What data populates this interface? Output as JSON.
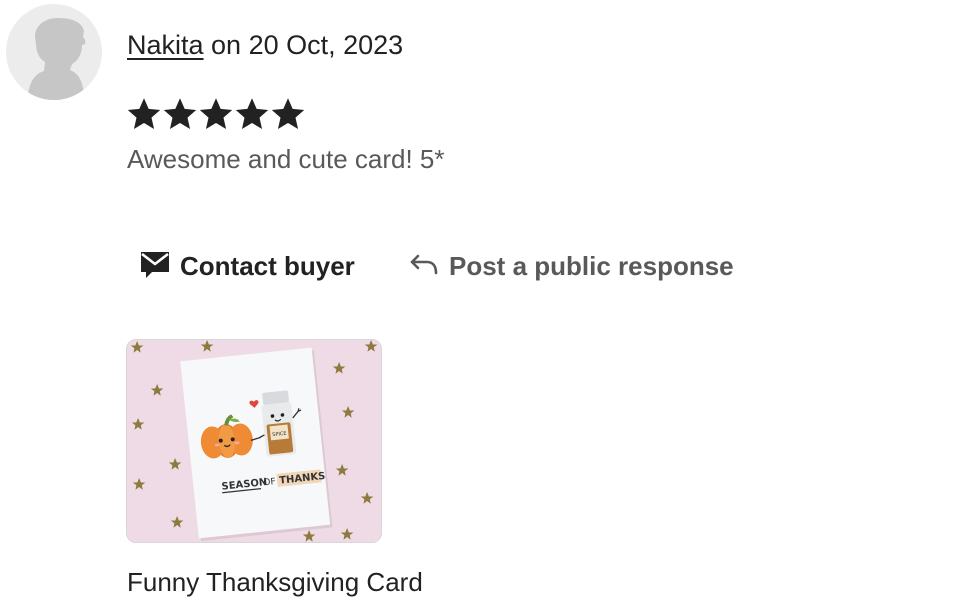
{
  "review": {
    "reviewer_name": "Nakita",
    "date_text": " on 20 Oct, 2023",
    "rating": 5,
    "rating_max": 5,
    "text": "Awesome and cute card! 5*"
  },
  "actions": {
    "contact_label": "Contact buyer",
    "respond_label": "Post a public response"
  },
  "product": {
    "title": "Funny Thanksgiving Card",
    "card_text": {
      "word1": "SEASON",
      "word2": "OF",
      "word3": "THANKS",
      "jar_label": "SPICE"
    }
  },
  "colors": {
    "text": "#222222",
    "muted": "#595959",
    "star": "#222222",
    "avatar_bg": "#ececec",
    "avatar_figure": "#c6c6c6",
    "thumb_bg": "#efdbe6",
    "pumpkin": "#e97a2c",
    "gold_star": "#8d7a3e"
  }
}
